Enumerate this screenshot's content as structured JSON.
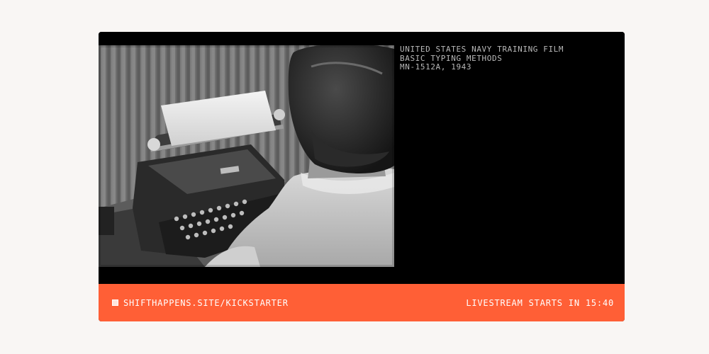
{
  "video": {
    "image_name": "woman-at-typewriter",
    "caption_lines": [
      "UNITED STATES NAVY TRAINING FILM",
      "BASIC TYPING METHODS",
      "MN-1512A, 1943"
    ]
  },
  "footer": {
    "link_icon": "square-icon",
    "link_text": "SHIFTHAPPENS.SITE/KICKSTARTER",
    "countdown_text": "LIVESTREAM STARTS IN 15:40"
  },
  "colors": {
    "page_background": "#f9f6f4",
    "player_background": "#000000",
    "accent_bar": "#ff5f36",
    "caption_text": "#b9b9b9"
  }
}
